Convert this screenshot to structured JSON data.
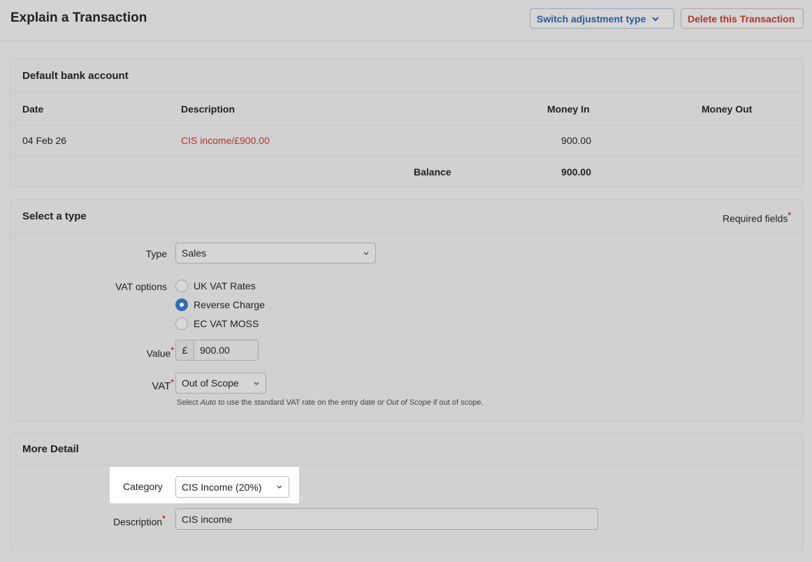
{
  "header": {
    "title": "Explain a Transaction",
    "switch_label": "Switch adjustment type",
    "delete_label": "Delete this Transaction"
  },
  "bank": {
    "title": "Default bank account",
    "columns": {
      "date": "Date",
      "description": "Description",
      "money_in": "Money In",
      "money_out": "Money Out"
    },
    "row": {
      "date": "04 Feb 26",
      "description": "CIS income/£900.00",
      "money_in": "900.00",
      "money_out": ""
    },
    "balance_label": "Balance",
    "balance_value": "900.00"
  },
  "select_type": {
    "title": "Select a type",
    "required_text": "Required fields",
    "required_star": "*",
    "type_label": "Type",
    "type_value": "Sales",
    "vat_options_label": "VAT options",
    "vat_options": [
      "UK VAT Rates",
      "Reverse Charge",
      "EC VAT MOSS"
    ],
    "vat_options_selected": "Reverse Charge",
    "value_label": "Value",
    "currency_symbol": "£",
    "value_amount": "900.00",
    "vat_label": "VAT",
    "vat_value": "Out of Scope",
    "hint": {
      "part1": "Select ",
      "auto": "Auto",
      "part2": " to use the standard VAT rate on the entry date or ",
      "oos": "Out of Scope",
      "part3": " if out of scope."
    }
  },
  "more_detail": {
    "title": "More Detail",
    "category_label": "Category",
    "category_value": "CIS Income (20%)",
    "description_label": "Description",
    "description_value": "CIS income"
  },
  "colors": {
    "accent_blue": "#2a5d9a",
    "danger_red": "#b5342c",
    "radio_selected": "#2f6db5"
  }
}
